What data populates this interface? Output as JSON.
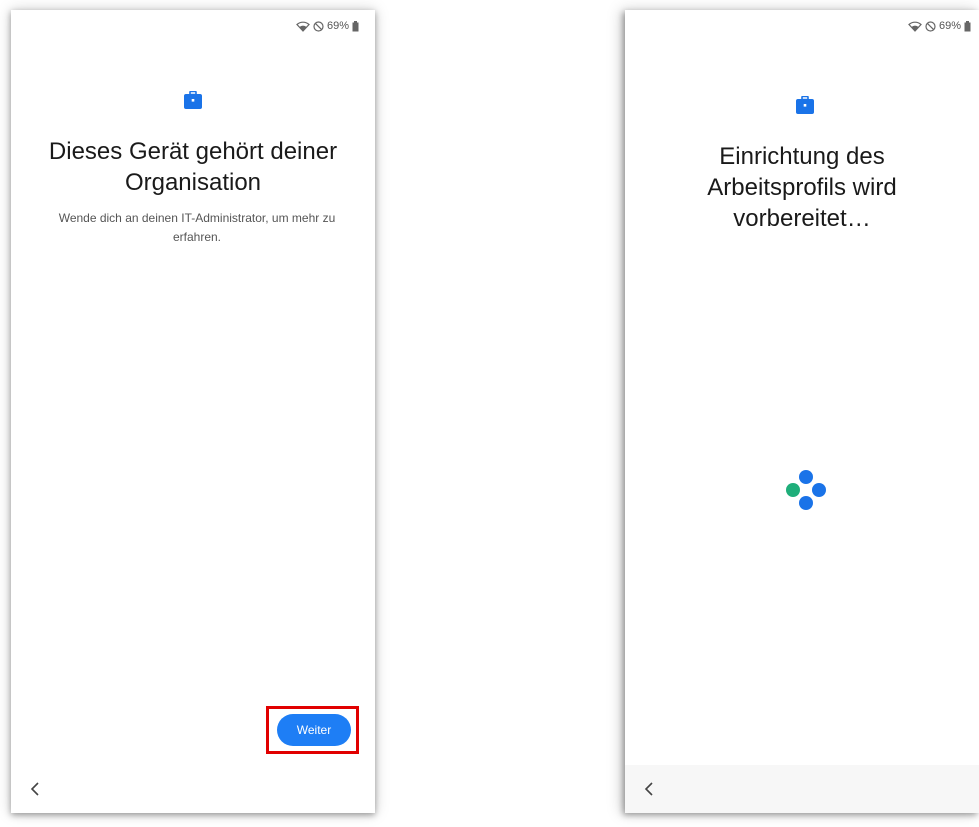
{
  "status_bar": {
    "battery_text": "69%",
    "icons": [
      "wifi-icon",
      "do-not-disturb-icon",
      "battery-icon"
    ]
  },
  "screen_1": {
    "title": "Dieses Gerät gehört deiner Organisation",
    "subtitle": "Wende dich an deinen IT-Administrator, um mehr zu erfahren.",
    "continue_button": "Weiter"
  },
  "screen_2": {
    "title": "Einrichtung des Arbeitsprofils wird vorbereitet…"
  },
  "colors": {
    "accent": "#1e7ef5",
    "work_icon": "#1a73e8",
    "highlight": "#e10000",
    "spinner_green": "#1fae7a",
    "spinner_blue": "#1a73e8"
  }
}
